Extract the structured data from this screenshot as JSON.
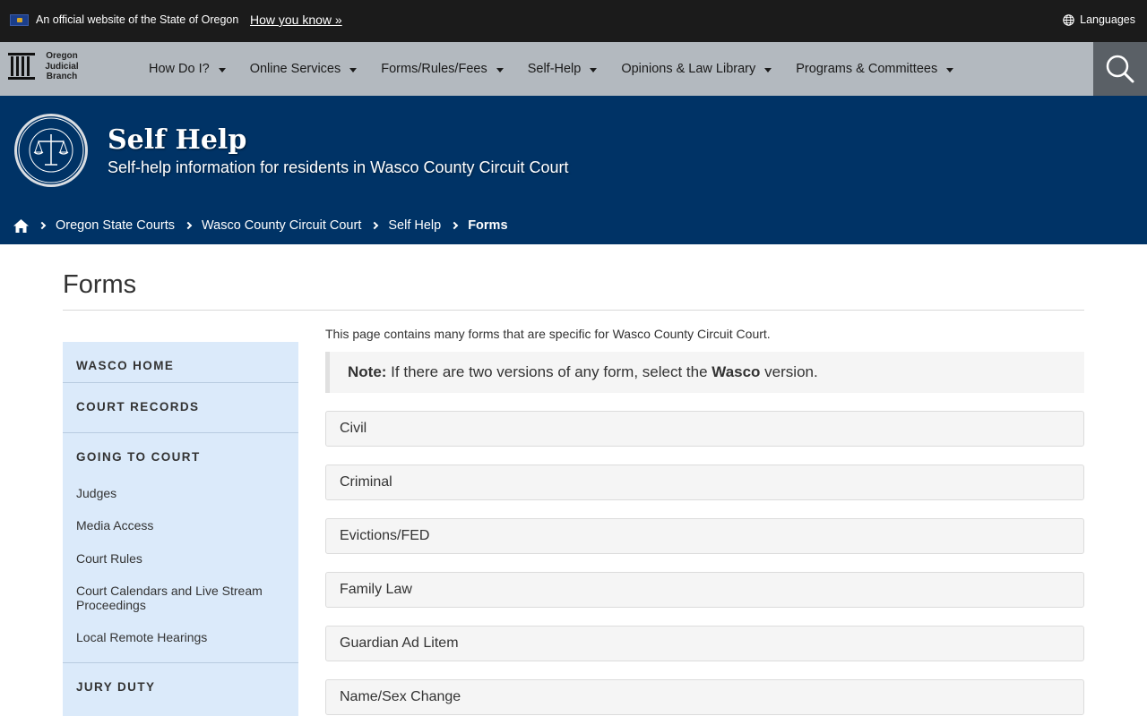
{
  "gov_banner": {
    "official_text": "An official website of the State of Oregon",
    "how_link": "How you know »",
    "languages": "Languages"
  },
  "logo": {
    "line1": "Oregon",
    "line2": "Judicial",
    "line3": "Branch"
  },
  "nav": {
    "items": [
      {
        "label": "How Do I?"
      },
      {
        "label": "Online Services"
      },
      {
        "label": "Forms/Rules/Fees"
      },
      {
        "label": "Self-Help"
      },
      {
        "label": "Opinions & Law Library"
      },
      {
        "label": "Programs & Committees"
      }
    ]
  },
  "hero": {
    "title": "Self Help",
    "subtitle": "Self-help information for residents in Wasco County Circuit Court"
  },
  "breadcrumb": {
    "items": [
      {
        "label": "Oregon State Courts"
      },
      {
        "label": "Wasco County Circuit Court"
      },
      {
        "label": "Self Help"
      },
      {
        "label": "Forms"
      }
    ]
  },
  "page": {
    "title": "Forms",
    "intro": "This page contains many forms that are specific for Wasco County Circuit Court.",
    "note_label": "Note:",
    "note_text_before": " If there are two versions of any form, select the ",
    "note_bold": "Wasco",
    "note_text_after": " version."
  },
  "sidebar": {
    "home": "WASCO HOME",
    "court_records": "COURT RECORDS",
    "going_to_court": "GOING TO COURT",
    "links": [
      {
        "label": "Judges"
      },
      {
        "label": "Media Access"
      },
      {
        "label": "Court Rules"
      },
      {
        "label": "Court Calendars and Live Stream Proceedings"
      },
      {
        "label": "Local Remote Hearings"
      }
    ],
    "jury_duty": "JURY DUTY"
  },
  "accordion": {
    "items": [
      {
        "label": "Civil"
      },
      {
        "label": "Criminal"
      },
      {
        "label": "Evictions/FED"
      },
      {
        "label": "Family Law"
      },
      {
        "label": "Guardian Ad Litem"
      },
      {
        "label": "Name/Sex Change"
      }
    ]
  },
  "colors": {
    "gov_banner_bg": "#1b1b1b",
    "nav_bg": "#b3b9bf",
    "hero_bg": "#003366",
    "sidebar_bg": "#dbeafa",
    "search_bg": "#5a6066"
  }
}
